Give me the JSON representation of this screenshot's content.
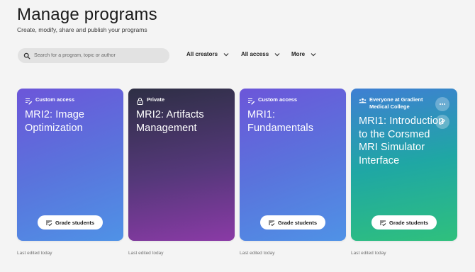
{
  "header": {
    "title": "Manage programs",
    "subtitle": "Create, modify, share and publish your programs"
  },
  "search": {
    "placeholder": "Search for a program, topic or author",
    "value": ""
  },
  "filters": [
    {
      "label": "All creators"
    },
    {
      "label": "All access"
    },
    {
      "label": "More"
    }
  ],
  "programs": [
    {
      "access": "Custom access",
      "access_icon": "custom-access-icon",
      "title": "MRI2: Image Optimization",
      "button": "Grade students",
      "edited": "Last edited today"
    },
    {
      "access": "Private",
      "access_icon": "lock-icon",
      "title": "MRI2: Artifacts Management",
      "button": "Grade students",
      "edited": "Last edited today"
    },
    {
      "access": "Custom access",
      "access_icon": "custom-access-icon",
      "title": "MRI1: Fundamentals",
      "button": "Grade students",
      "edited": "Last edited today"
    },
    {
      "access": "Everyone at Gradient Medical College",
      "access_icon": "group-icon",
      "title": "MRI1: Introduction to the Corsmed MRI Simulator Interface",
      "button": "Grade students",
      "edited": "Last edited today"
    }
  ],
  "colors": {
    "background": "#f4f4f4",
    "card_blue_purple": "#5a73dc",
    "card_dark_purple": "#55387a",
    "card_teal_green": "#1fa7a4"
  }
}
